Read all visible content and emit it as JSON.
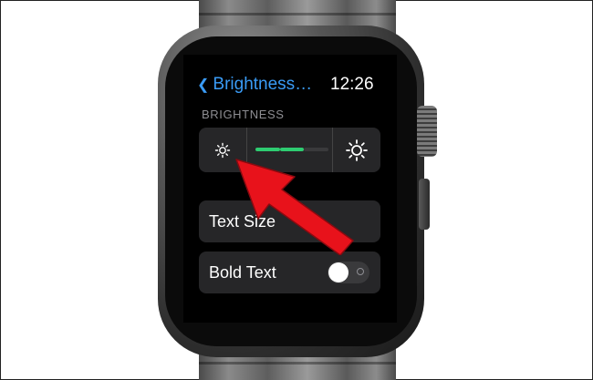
{
  "nav": {
    "back_label": "Brightness…",
    "time": "12:26"
  },
  "brightness_section": {
    "label": "BRIGHTNESS",
    "level_segments_on": 2,
    "level_segments_total": 3,
    "active_color": "#2ecc71",
    "inactive_color": "#3a3a3c"
  },
  "rows": {
    "text_size": "Text Size",
    "bold_text": "Bold Text",
    "bold_text_on": false
  },
  "annotation": {
    "arrow_color": "#e8121b"
  },
  "colors": {
    "accent": "#3a9bf5",
    "cell_bg": "#262628",
    "screen_bg": "#000000"
  }
}
